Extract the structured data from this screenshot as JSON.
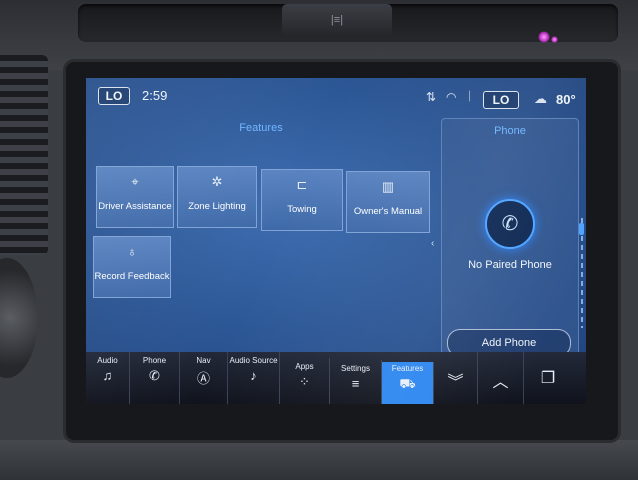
{
  "hardware": {
    "hazard_glyph": "|≡|"
  },
  "status_bar": {
    "driver_temp_setting": "LO",
    "time": "2:59",
    "passenger_temp_setting": "LO",
    "outside_temp": "80°",
    "icons": [
      "signal-icon",
      "wifi-icon",
      "weather-icon"
    ]
  },
  "features": {
    "title": "Features",
    "tiles": [
      {
        "label": "Driver Assistance",
        "icon": "driver-assist-icon",
        "glyph": "⌖"
      },
      {
        "label": "Zone Lighting",
        "icon": "zone-lighting-icon",
        "glyph": "✲"
      },
      {
        "label": "Towing",
        "icon": "trailer-icon",
        "glyph": "⊏"
      },
      {
        "label": "Owner's Manual",
        "icon": "manual-icon",
        "glyph": "▥"
      },
      {
        "label": "Record Feedback",
        "icon": "microphone-icon",
        "glyph": "♁"
      }
    ]
  },
  "phone_panel": {
    "title": "Phone",
    "status": "No Paired Phone",
    "add_button": "Add Phone",
    "icon_glyph": "✆"
  },
  "nav_bar": {
    "items": [
      {
        "label": "Audio",
        "glyph": "♫",
        "icon": "music-note-icon"
      },
      {
        "label": "Phone",
        "glyph": "✆",
        "icon": "phone-icon"
      },
      {
        "label": "Nav",
        "glyph": "Ⓐ",
        "icon": "navigation-icon"
      },
      {
        "label": "Audio Source",
        "glyph": "♪",
        "icon": "audio-source-icon"
      },
      {
        "label": "Apps",
        "glyph": "⁘",
        "icon": "apps-grid-icon"
      },
      {
        "label": "Settings",
        "glyph": "≡",
        "icon": "settings-sliders-icon"
      },
      {
        "label": "Features",
        "glyph": "⛟",
        "icon": "truck-icon"
      }
    ],
    "controls": [
      {
        "glyph": "︾",
        "icon": "chevron-down-icon"
      },
      {
        "glyph": "︿",
        "icon": "chevron-up-icon"
      },
      {
        "glyph": "❐",
        "icon": "copy-windows-icon"
      }
    ]
  },
  "colors": {
    "accent": "#2e87f0",
    "title_blue": "#6fb6ff"
  }
}
